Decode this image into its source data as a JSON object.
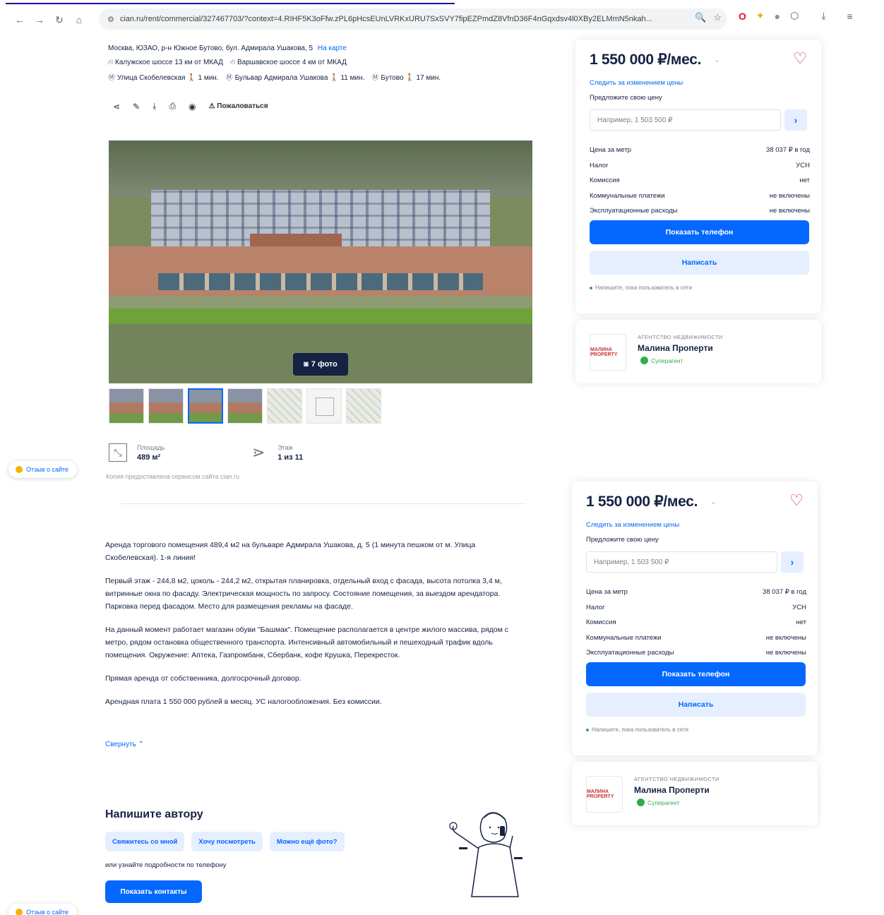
{
  "browser": {
    "url": "cian.ru/rent/commercial/327467703/?context=4.RIHF5K3oFfw.zPL6pHcsEUnLVRKxURU7SxSVY7fipEZPmdZ8VfnD36F4nGqxdsv4l0XBy2ELMmN5nkah...",
    "controls": {
      "back": "←",
      "forward": "→",
      "reload": "↻",
      "home": "⌂",
      "site_info": "⚙",
      "zoom": "🔍",
      "bookmark": "☆",
      "download": "⤓",
      "menu": "≡"
    },
    "extensions": [
      "O",
      "✦",
      "●",
      "⬡"
    ]
  },
  "listing": {
    "address": "Москва, ЮЗАО, р-н Южное Бутово, бул. Адмирала Ушакова, 5",
    "map_link": "На карте",
    "highways": [
      {
        "name": "Калужское шоссе",
        "dist": "13 км от МКАД"
      },
      {
        "name": "Варшавское шоссе",
        "dist": "4 км от МКАД"
      }
    ],
    "metro": [
      {
        "name": "Улица Скобелевская",
        "time": "1 мин."
      },
      {
        "name": "Бульвар Адмирала Ушакова",
        "time": "11 мин."
      },
      {
        "name": "Бутово",
        "time": "17 мин."
      }
    ],
    "toolbar": {
      "share": "⋖",
      "edit": "✎",
      "download": "⤓",
      "print": "⎙",
      "hide": "◉",
      "complain_icon": "⚠",
      "complain": "Пожаловаться"
    },
    "photo_button": "7 фото",
    "facts": [
      {
        "label": "Площадь",
        "value": "489 м²",
        "icon": "area-icon",
        "glyph": "⤡"
      },
      {
        "label": "Этаж",
        "value": "1 из 11",
        "icon": "stairs-icon",
        "glyph": "⋗"
      }
    ],
    "cut_text": "Копия предоставлена сервисом сайта cian.ru",
    "description": [
      "Аренда торгового помещения 489,4 м2 на бульваре Адмирала Ушакова, д. 5 (1 минута пешком от м. Улица Скобелевская). 1-я линия!",
      "Первый этаж - 244,8 м2, цоколь - 244,2 м2, открытая планировка, отдельный вход с фасада, высота потолка 3,4 м, витринные окна по фасаду. Электрическая мощность по запросу. Состояние помещения, за выездом арендатора. Парковка перед фасадом. Место для размещения рекламы на фасаде.",
      "На данный момент работает магазин обуви \"Башмак\". Помещение располагается в центре жилого массива, рядом с метро, рядом остановка общественного транспорта. Интенсивный автомобильный и пешеходный трафик вдоль помещения. Окружение: Аптека, Газпромбанк, Сбербанк, кофе Крушка, Перекресток.",
      "Прямая аренда от собственника, долгосрочный договор.",
      "Арендная плата 1 550 000 рублей в месяц. УС налогообложения. Без комиссии."
    ],
    "collapse": "Свернуть ⌃"
  },
  "feedback": {
    "label": "Отзыв о сайте"
  },
  "contact_author": {
    "title": "Напишите автору",
    "chips": [
      "Свяжитесь со мной",
      "Хочу посмотреть",
      "Можно ещё фото?"
    ],
    "or_phone": "или узнайте подробности по телефону",
    "button": "Показать контакты"
  },
  "price_card": {
    "price": "1 550 000 ₽/мес.",
    "caret": "⌄",
    "heart": "♡",
    "follow": "Следить за изменением цены",
    "offer_label": "Предложите свою цену",
    "offer_placeholder": "Например, 1 503 500 ₽",
    "offer_go": "›",
    "rows": [
      {
        "k": "Цена за метр",
        "v": "38 037 ₽ в год"
      },
      {
        "k": "Налог",
        "v": "УСН"
      },
      {
        "k": "Комиссия",
        "v": "нет"
      },
      {
        "k": "Коммунальные платежи",
        "v": "не включены"
      },
      {
        "k": "Эксплуатационные расходы",
        "v": "не включены"
      }
    ],
    "show_phone": "Показать телефон",
    "write": "Написать",
    "note": "Напишите, пока пользователь в сети"
  },
  "agent": {
    "kind": "АГЕНТСТВО НЕДВИЖИМОСТИ",
    "name": "Малина Проперти",
    "badge": "Суперагент",
    "logo_text": "МАЛИНА PROPERTY"
  }
}
